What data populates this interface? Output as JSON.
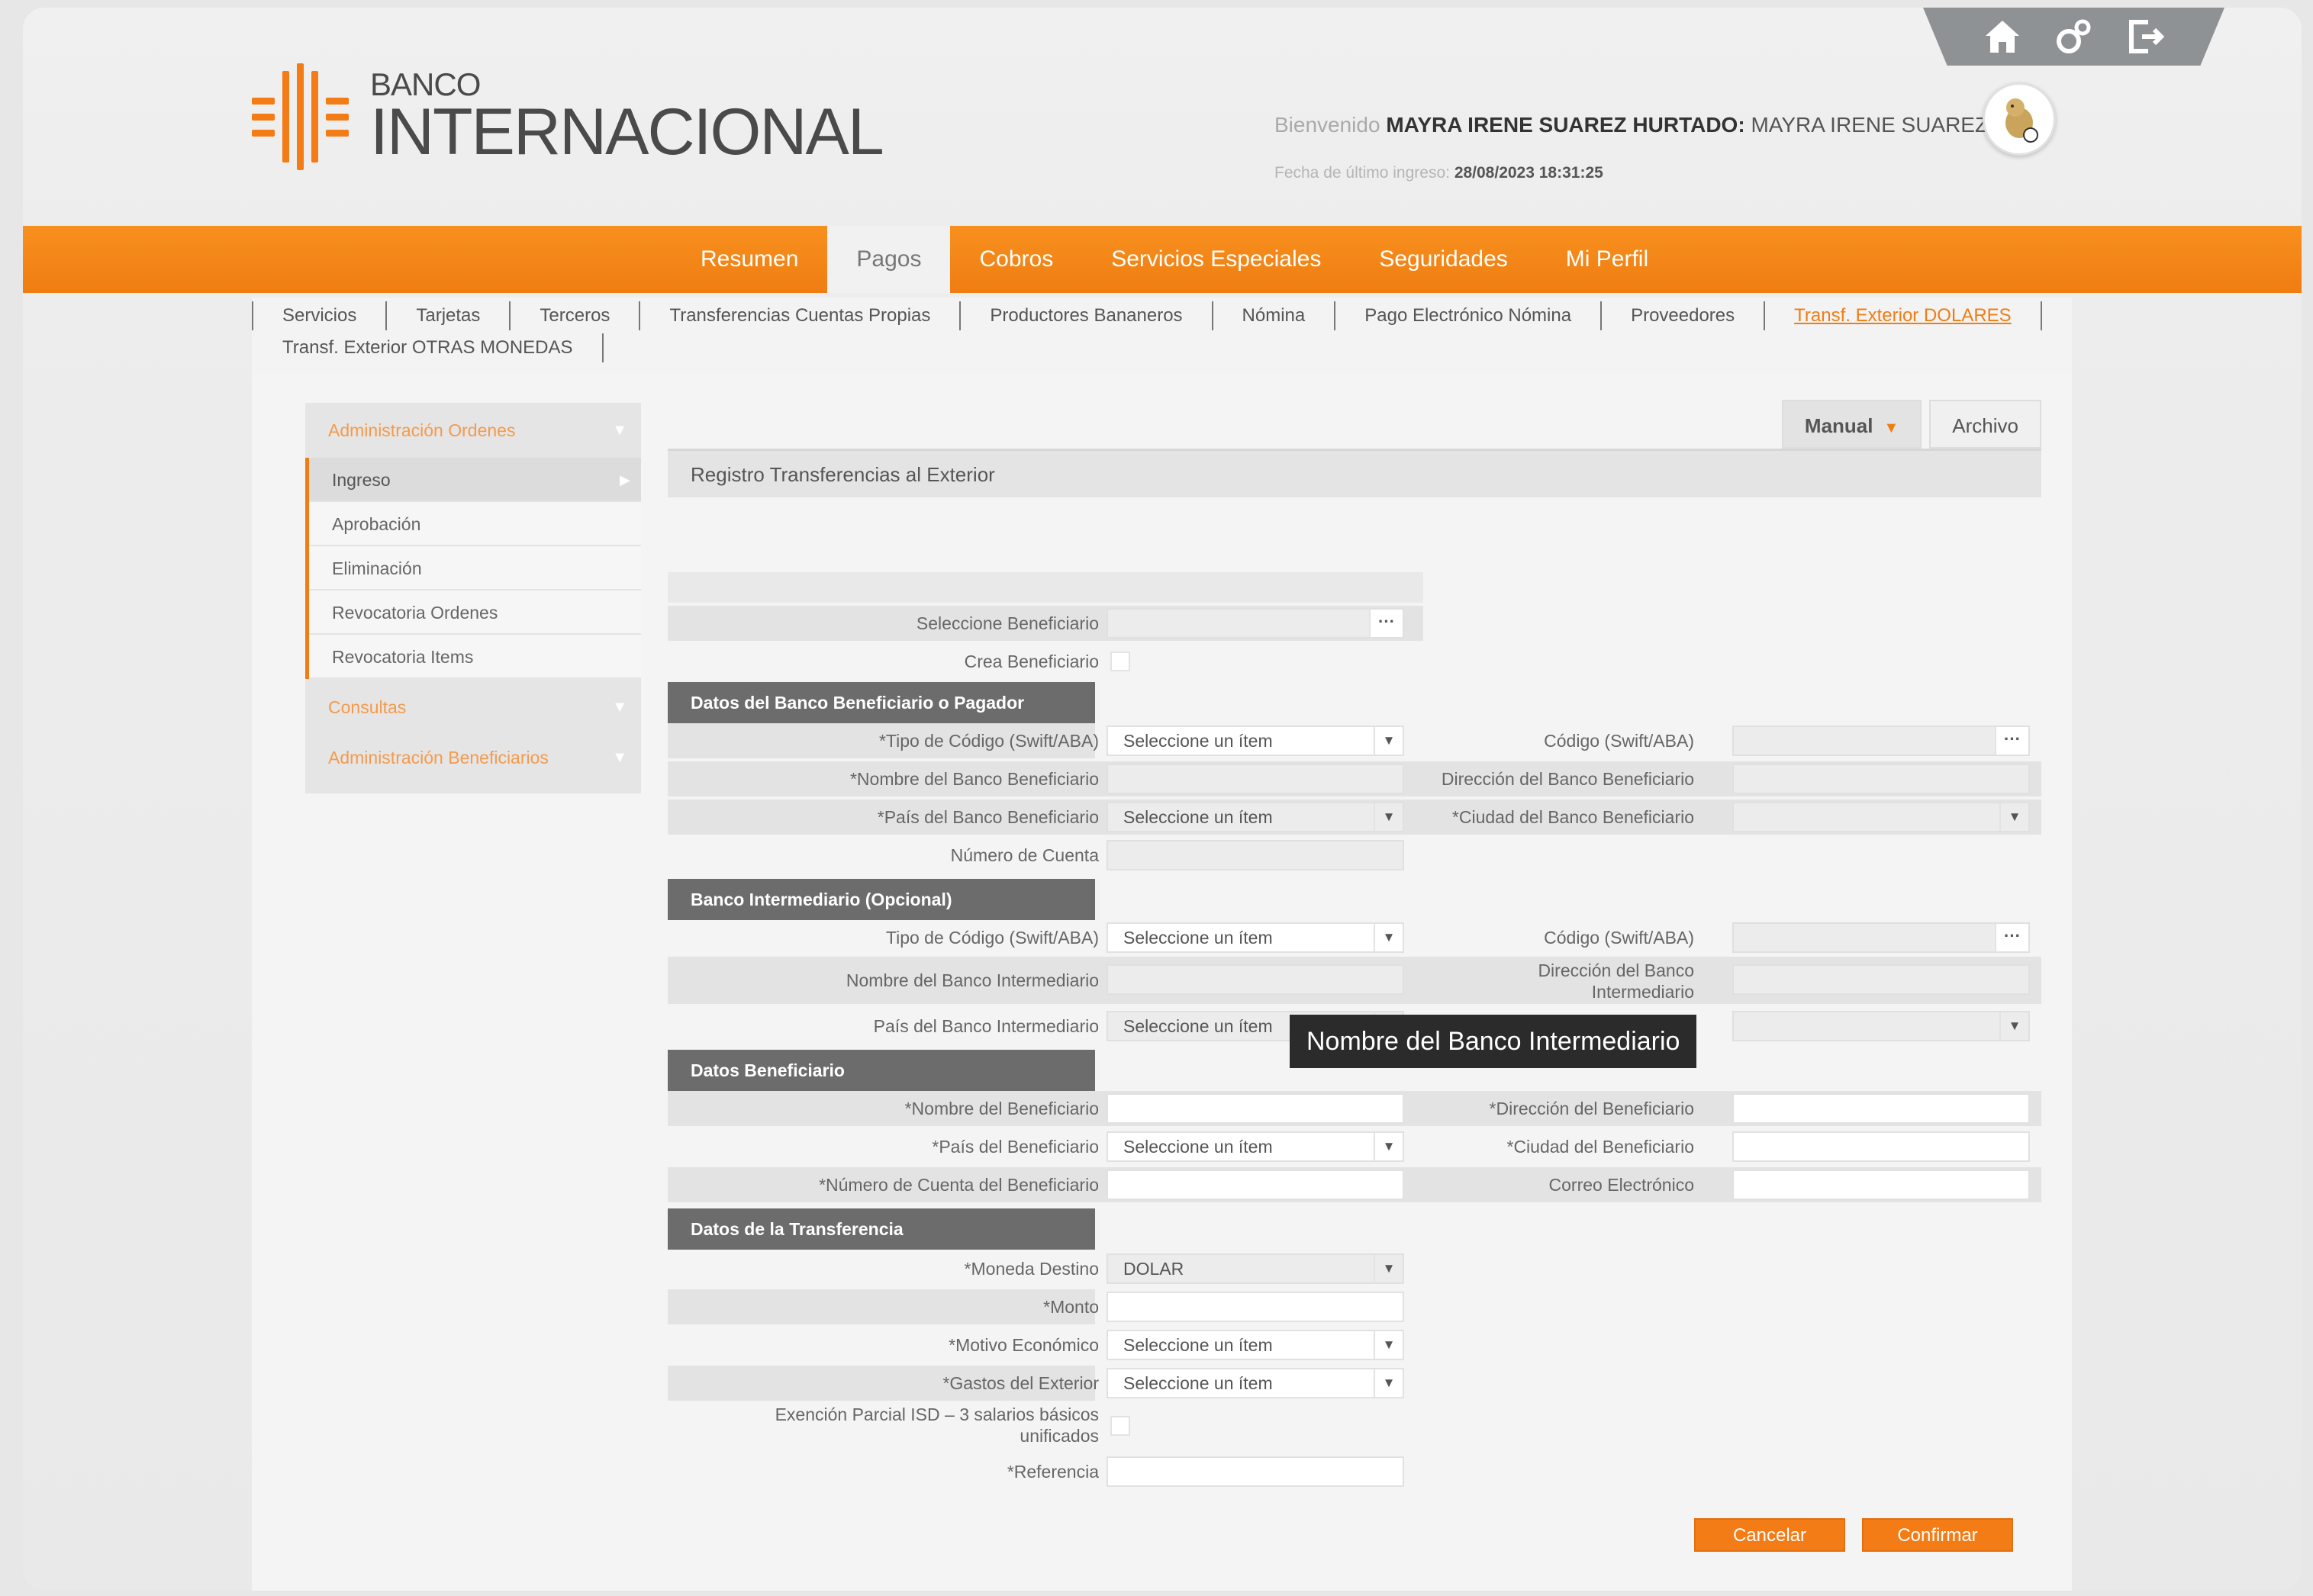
{
  "header": {
    "logo_small": "BANCO",
    "logo_big": "INTERNACIONAL",
    "welcome_prefix": "Bienvenido",
    "user_full": "MAYRA IRENE SUAREZ HURTADO:",
    "user_short": "MAYRA IRENE SUAREZ",
    "last_login_label": "Fecha de último ingreso:",
    "last_login_value": "28/08/2023 18:31:25",
    "icons": [
      "home-icon",
      "settings-icon",
      "logout-icon"
    ]
  },
  "nav": {
    "items": [
      "Resumen",
      "Pagos",
      "Cobros",
      "Servicios Especiales",
      "Seguridades",
      "Mi Perfil"
    ],
    "active": "Pagos"
  },
  "subnav": {
    "row1": [
      "Servicios",
      "Tarjetas",
      "Terceros",
      "Transferencias Cuentas Propias",
      "Productores Bananeros",
      "Nómina",
      "Pago Electrónico Nómina",
      "Proveedores",
      "Transf. Exterior DOLARES"
    ],
    "row2": [
      "Transf. Exterior OTRAS MONEDAS"
    ],
    "active": "Transf. Exterior DOLARES"
  },
  "sidebar": {
    "section1": "Administración Ordenes",
    "items": [
      "Ingreso",
      "Aprobación",
      "Eliminación",
      "Revocatoria Ordenes",
      "Revocatoria Items"
    ],
    "section2": "Consultas",
    "section3": "Administración Beneficiarios"
  },
  "tabs": {
    "manual": "Manual",
    "archivo": "Archivo"
  },
  "page_title": "Registro Transferencias al Exterior",
  "form": {
    "seleccione_beneficiario": "Seleccione Beneficiario",
    "crea_beneficiario": "Crea Beneficiario",
    "sec_banco": "Datos del Banco Beneficiario o Pagador",
    "tipo_codigo_req": "*Tipo de Código (Swift/ABA)",
    "codigo_swift": "Código (Swift/ABA)",
    "nombre_banco_benef": "*Nombre del Banco Beneficiario",
    "direccion_banco_benef": "Dirección del Banco Beneficiario",
    "pais_banco_benef": "*País del Banco Beneficiario",
    "ciudad_banco_benef": "*Ciudad del Banco Beneficiario",
    "numero_cuenta": "Número de Cuenta",
    "sec_intermediario": "Banco Intermediario (Opcional)",
    "tipo_codigo": "Tipo de Código (Swift/ABA)",
    "codigo_swift_2": "Código (Swift/ABA)",
    "nombre_banco_inter": "Nombre del Banco Intermediario",
    "direccion_banco_inter": "Dirección del Banco Intermediario",
    "pais_banco_inter": "País del Banco Intermediario",
    "sec_beneficiario": "Datos Beneficiario",
    "nombre_benef": "*Nombre del Beneficiario",
    "direccion_benef": "*Dirección del Beneficiario",
    "pais_benef": "*País del Beneficiario",
    "ciudad_benef": "*Ciudad del Beneficiario",
    "numero_cuenta_benef": "*Número de Cuenta del Beneficiario",
    "correo": "Correo Electrónico",
    "sec_transferencia": "Datos de la Transferencia",
    "moneda_destino": "*Moneda Destino",
    "moneda_value": "DOLAR",
    "monto": "*Monto",
    "motivo": "*Motivo Económico",
    "gastos": "*Gastos del Exterior",
    "exencion": "Exención Parcial ISD – 3 salarios básicos unificados",
    "referencia": "*Referencia",
    "select_placeholder": "Seleccione un ítem"
  },
  "tooltip": "Nombre del Banco Intermediario",
  "buttons": {
    "cancelar": "Cancelar",
    "confirmar": "Confirmar"
  },
  "colors": {
    "brand_orange": "#f37c16",
    "section_gray": "#6c6c6c"
  }
}
